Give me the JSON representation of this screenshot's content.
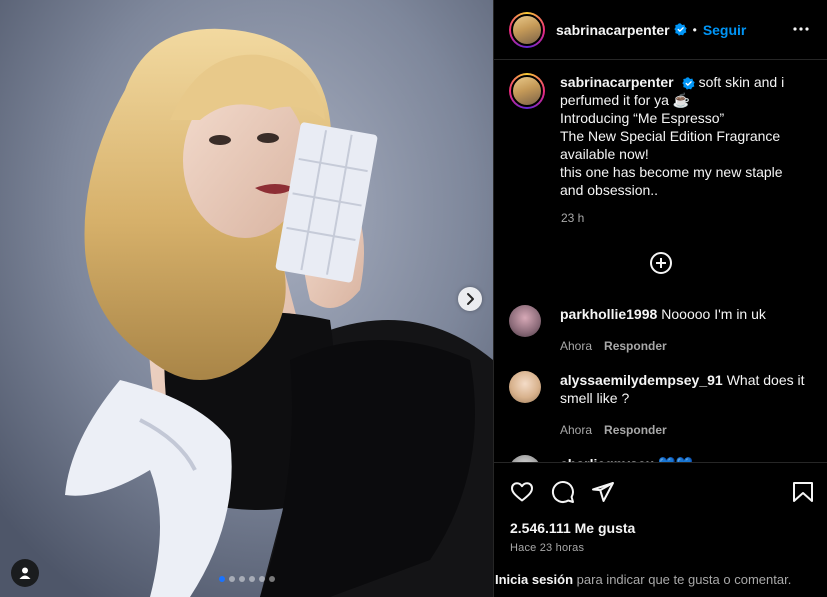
{
  "post": {
    "author": "sabrinacarpenter",
    "follow_label": "Seguir",
    "separator": "•",
    "caption_lines": [
      "soft skin and i",
      "perfumed it for ya ☕",
      "Introducing “Me Espresso”",
      "The New Special Edition Fragrance",
      "available now!",
      "this one has become my new staple",
      "and obsession.."
    ],
    "caption_time": "23 h",
    "carousel": {
      "total": 6,
      "active_index": 0
    }
  },
  "comments": [
    {
      "user": "parkhollie1998",
      "text": "Nooooo I'm in uk",
      "time": "Ahora",
      "reply_label": "Responder"
    },
    {
      "user": "alyssaemilydempsey_91",
      "text": "What does it smell like ?",
      "time": "Ahora",
      "reply_label": "Responder"
    },
    {
      "user": "charliegnyseu",
      "text": "💙💙",
      "time": "",
      "reply_label": ""
    }
  ],
  "footer": {
    "likes": "2.546.111 Me gusta",
    "posted_ago": "Hace 23 horas",
    "login_link": "Inicia sesión",
    "login_text": "para indicar que te gusta o comentar."
  },
  "icons": {
    "verified": "verified-badge-icon",
    "more": "more-options-icon",
    "add": "plus-circle-icon",
    "like": "heart-icon",
    "comment": "comment-icon",
    "share": "share-icon",
    "save": "bookmark-icon",
    "next": "chevron-right-icon",
    "tag": "user-tag-icon"
  },
  "colors": {
    "accent": "#0095f6",
    "verified": "#0095f6",
    "background": "#000000",
    "secondary_text": "#a8a8a8"
  }
}
